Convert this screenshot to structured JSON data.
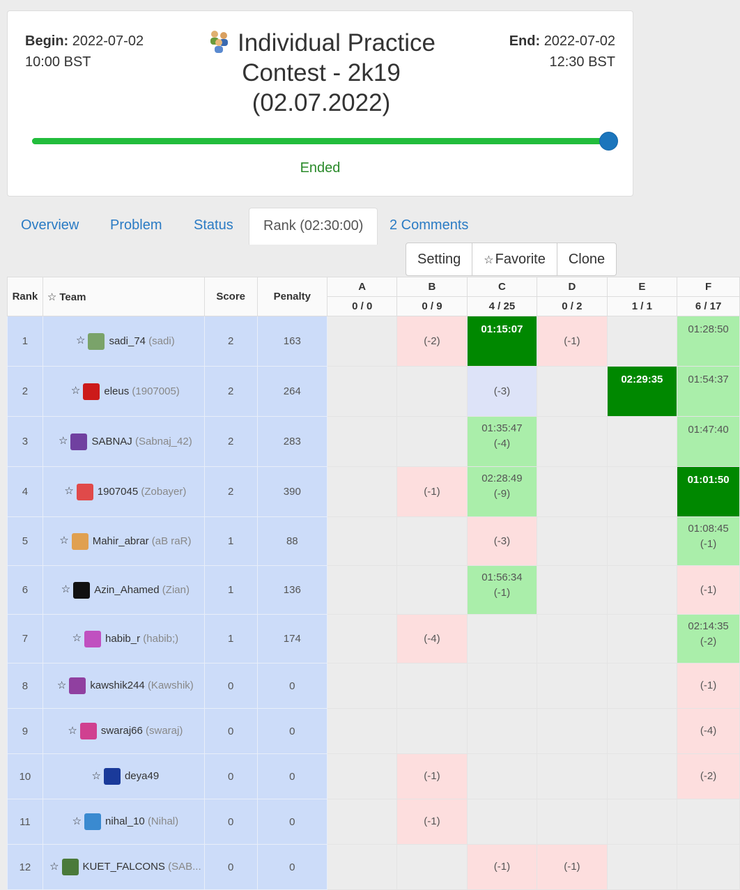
{
  "contest": {
    "begin_label": "Begin:",
    "begin_date": "2022-07-02",
    "begin_time": "10:00 BST",
    "end_label": "End:",
    "end_date": "2022-07-02",
    "end_time": "12:30 BST",
    "title": "Individual Practice Contest - 2k19 (02.07.2022)",
    "title_icon": "contest-users-icon",
    "progress_fraction": 1.0,
    "status": "Ended"
  },
  "tabs": [
    {
      "label": "Overview"
    },
    {
      "label": "Problem"
    },
    {
      "label": "Status"
    },
    {
      "label": "Rank (02:30:00)"
    },
    {
      "label": "2 Comments"
    }
  ],
  "actions": {
    "setting": "Setting",
    "favorite_icon": "☆",
    "favorite": "Favorite",
    "clone": "Clone"
  },
  "table": {
    "headers": {
      "rank": "Rank",
      "team_star": "☆",
      "team": "Team",
      "score": "Score",
      "penalty": "Penalty"
    },
    "problems": [
      {
        "letter": "A",
        "stat": "0 / 0"
      },
      {
        "letter": "B",
        "stat": "0 / 9"
      },
      {
        "letter": "C",
        "stat": "4 / 25"
      },
      {
        "letter": "D",
        "stat": "0 / 2"
      },
      {
        "letter": "E",
        "stat": "1 / 1"
      },
      {
        "letter": "F",
        "stat": "6 / 17"
      }
    ],
    "colors": {
      "accepted": "#aaeeaa",
      "first_blood": "#008800",
      "wrong": "#fddede",
      "pending": "#dde3f8",
      "rank_bg": "#ccdcf9"
    },
    "rows": [
      {
        "rank": "1",
        "user": "sadi_74",
        "nick": "(sadi)",
        "score": "2",
        "penalty": "163",
        "avatar": "#7aa36a",
        "cells": [
          {
            "s": "none"
          },
          {
            "s": "wa",
            "tries": "(-2)"
          },
          {
            "s": "fb",
            "time": "01:15:07"
          },
          {
            "s": "wa",
            "tries": "(-1)"
          },
          {
            "s": "none"
          },
          {
            "s": "ac",
            "time": "01:28:50"
          }
        ]
      },
      {
        "rank": "2",
        "user": "eleus",
        "nick": "(1907005)",
        "score": "2",
        "penalty": "264",
        "avatar": "#cc1a1a",
        "cells": [
          {
            "s": "none"
          },
          {
            "s": "none"
          },
          {
            "s": "pend",
            "tries": "(-3)"
          },
          {
            "s": "none"
          },
          {
            "s": "fb",
            "time": "02:29:35"
          },
          {
            "s": "ac",
            "time": "01:54:37"
          }
        ]
      },
      {
        "rank": "3",
        "user": "SABNAJ",
        "nick": "(Sabnaj_42)",
        "score": "2",
        "penalty": "283",
        "avatar": "#7040a0",
        "cells": [
          {
            "s": "none"
          },
          {
            "s": "none"
          },
          {
            "s": "ac",
            "time": "01:35:47",
            "tries": "(-4)"
          },
          {
            "s": "none"
          },
          {
            "s": "none"
          },
          {
            "s": "ac",
            "time": "01:47:40"
          }
        ]
      },
      {
        "rank": "4",
        "user": "1907045",
        "nick": "(Zobayer)",
        "score": "2",
        "penalty": "390",
        "avatar": "#e04a4a",
        "cells": [
          {
            "s": "none"
          },
          {
            "s": "wa",
            "tries": "(-1)"
          },
          {
            "s": "ac",
            "time": "02:28:49",
            "tries": "(-9)"
          },
          {
            "s": "none"
          },
          {
            "s": "none"
          },
          {
            "s": "fb",
            "time": "01:01:50"
          }
        ]
      },
      {
        "rank": "5",
        "user": "Mahir_abrar",
        "nick": "(aB raR)",
        "score": "1",
        "penalty": "88",
        "avatar": "#e0a050",
        "cells": [
          {
            "s": "none"
          },
          {
            "s": "none"
          },
          {
            "s": "wa",
            "tries": "(-3)"
          },
          {
            "s": "none"
          },
          {
            "s": "none"
          },
          {
            "s": "ac",
            "time": "01:08:45",
            "tries": "(-1)"
          }
        ]
      },
      {
        "rank": "6",
        "user": "Azin_Ahamed",
        "nick": "(Zian)",
        "score": "1",
        "penalty": "136",
        "avatar": "#111111",
        "cells": [
          {
            "s": "none"
          },
          {
            "s": "none"
          },
          {
            "s": "ac",
            "time": "01:56:34",
            "tries": "(-1)"
          },
          {
            "s": "none"
          },
          {
            "s": "none"
          },
          {
            "s": "wa",
            "tries": "(-1)"
          }
        ]
      },
      {
        "rank": "7",
        "user": "habib_r",
        "nick": "(habib;)",
        "score": "1",
        "penalty": "174",
        "avatar": "#c050c0",
        "cells": [
          {
            "s": "none"
          },
          {
            "s": "wa",
            "tries": "(-4)"
          },
          {
            "s": "none"
          },
          {
            "s": "none"
          },
          {
            "s": "none"
          },
          {
            "s": "ac",
            "time": "02:14:35",
            "tries": "(-2)"
          }
        ]
      },
      {
        "rank": "8",
        "user": "kawshik244",
        "nick": "(Kawshik)",
        "score": "0",
        "penalty": "0",
        "avatar": "#9040a0",
        "cells": [
          {
            "s": "none"
          },
          {
            "s": "none"
          },
          {
            "s": "none"
          },
          {
            "s": "none"
          },
          {
            "s": "none"
          },
          {
            "s": "wa",
            "tries": "(-1)"
          }
        ]
      },
      {
        "rank": "9",
        "user": "swaraj66",
        "nick": "(swaraj)",
        "score": "0",
        "penalty": "0",
        "avatar": "#d04090",
        "cells": [
          {
            "s": "none"
          },
          {
            "s": "none"
          },
          {
            "s": "none"
          },
          {
            "s": "none"
          },
          {
            "s": "none"
          },
          {
            "s": "wa",
            "tries": "(-4)"
          }
        ]
      },
      {
        "rank": "10",
        "user": "deya49",
        "nick": "",
        "score": "0",
        "penalty": "0",
        "avatar": "#1a3a9a",
        "cells": [
          {
            "s": "none"
          },
          {
            "s": "wa",
            "tries": "(-1)"
          },
          {
            "s": "none"
          },
          {
            "s": "none"
          },
          {
            "s": "none"
          },
          {
            "s": "wa",
            "tries": "(-2)"
          }
        ]
      },
      {
        "rank": "11",
        "user": "nihal_10",
        "nick": "(Nihal)",
        "score": "0",
        "penalty": "0",
        "avatar": "#3a8ad0",
        "cells": [
          {
            "s": "none"
          },
          {
            "s": "wa",
            "tries": "(-1)"
          },
          {
            "s": "none"
          },
          {
            "s": "none"
          },
          {
            "s": "none"
          },
          {
            "s": "none"
          }
        ]
      },
      {
        "rank": "12",
        "user": "KUET_FALCONS",
        "nick": "(SAB...",
        "score": "0",
        "penalty": "0",
        "avatar": "#4a7a3a",
        "cells": [
          {
            "s": "none"
          },
          {
            "s": "none"
          },
          {
            "s": "wa",
            "tries": "(-1)"
          },
          {
            "s": "wa",
            "tries": "(-1)"
          },
          {
            "s": "none"
          },
          {
            "s": "none"
          }
        ]
      }
    ]
  }
}
